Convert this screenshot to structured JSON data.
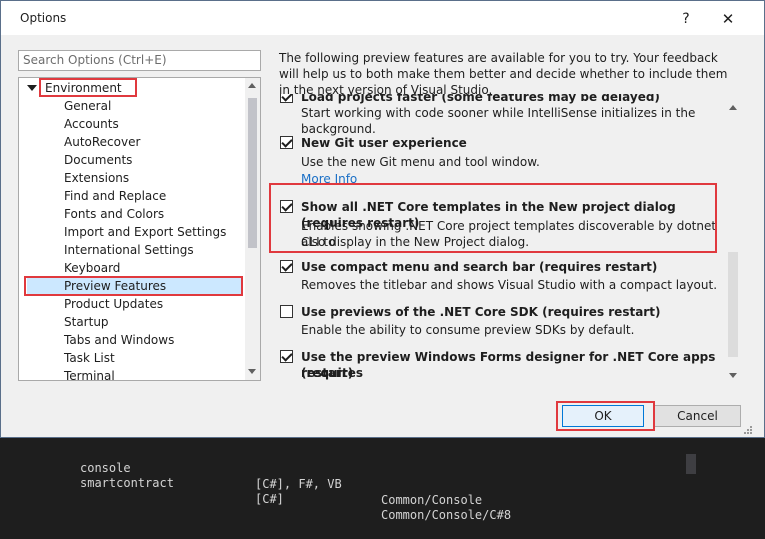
{
  "dialog": {
    "title": "Options",
    "help_glyph": "?",
    "close_glyph": "✕"
  },
  "search": {
    "placeholder": "Search Options (Ctrl+E)"
  },
  "tree": {
    "root": "Environment",
    "items": [
      "General",
      "Accounts",
      "AutoRecover",
      "Documents",
      "Extensions",
      "Find and Replace",
      "Fonts and Colors",
      "Import and Export Settings",
      "International Settings",
      "Keyboard",
      "Preview Features",
      "Product Updates",
      "Startup",
      "Tabs and Windows",
      "Task List",
      "Terminal"
    ],
    "selected": "Preview Features"
  },
  "description": "The following preview features are available for you to try. Your feedback will help us to both make them better and decide whether to include them in the next version of Visual Studio.",
  "features": [
    {
      "title": "Load projects faster (some features may be delayed)",
      "desc": "Start working with code sooner while IntelliSense initializes in the background.",
      "checked": true
    },
    {
      "title": "New Git user experience",
      "desc": "Use the new Git menu and tool window.",
      "link": "More Info",
      "checked": true
    },
    {
      "title": "Show all .NET Core templates in the New project dialog (requires restart)",
      "desc1": "Enables showing .NET Core project templates discoverable by dotnet CLI to",
      "desc2": "also display in the New Project dialog.",
      "checked": true
    },
    {
      "title": "Use compact menu and search bar (requires restart)",
      "desc": "Removes the titlebar and shows Visual Studio with a compact layout.",
      "checked": true
    },
    {
      "title": "Use previews of the .NET Core SDK (requires restart)",
      "desc": "Enable the ability to consume preview SDKs by default.",
      "checked": false
    },
    {
      "title1": "Use the preview Windows Forms designer for .NET Core apps (requires",
      "title2": "restart)",
      "checked": true
    }
  ],
  "buttons": {
    "ok": "OK",
    "cancel": "Cancel"
  },
  "terminal": {
    "rows": [
      {
        "name": "console",
        "lang": "[C#], F#, VB",
        "tags": "Common/Console"
      },
      {
        "name": "smartcontract",
        "lang": "[C#]",
        "tags": "Common/Console/C#8"
      }
    ]
  },
  "colors": {
    "highlight": "#e0393e",
    "selection": "#cce8ff",
    "link": "#1a6fc6"
  }
}
